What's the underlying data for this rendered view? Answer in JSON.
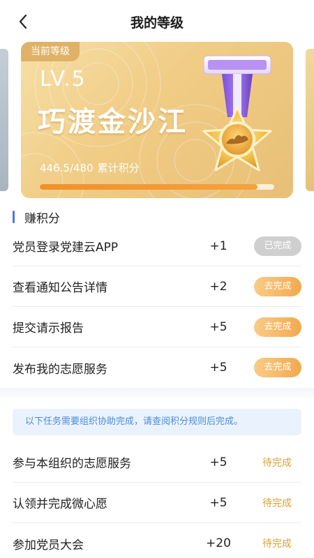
{
  "header": {
    "title": "我的等级",
    "back_icon": "chevron-left-icon"
  },
  "level_card": {
    "tag": "当前等级",
    "level": "LV.5",
    "level_name": "巧渡金沙江",
    "points": "446.5/480",
    "points_label": "累计积分",
    "progress_fraction": 0.93,
    "medal_icon": "star-medal-icon"
  },
  "earn_section": {
    "title": "赚积分",
    "tasks": [
      {
        "name": "党员登录党建云APP",
        "points": "+1",
        "status": "已完成",
        "state": "done"
      },
      {
        "name": "查看通知公告详情",
        "points": "+2",
        "status": "去完成",
        "state": "todo"
      },
      {
        "name": "提交请示报告",
        "points": "+5",
        "status": "去完成",
        "state": "todo"
      },
      {
        "name": "发布我的志愿服务",
        "points": "+5",
        "status": "去完成",
        "state": "todo"
      }
    ]
  },
  "org_section": {
    "notice": "以下任务需要组织协助完成，请查阅积分规则后完成。",
    "tasks": [
      {
        "name": "参与本组织的志愿服务",
        "points": "+5",
        "status": "待完成"
      },
      {
        "name": "认领并完成微心愿",
        "points": "+5",
        "status": "待完成"
      },
      {
        "name": "参加党员大会",
        "points": "+20",
        "status": "待完成"
      }
    ]
  },
  "colors": {
    "accent_blue": "#4a7be0",
    "progress": "#f0902b",
    "pending_text": "#d9a032",
    "done_pill": "#cfcfcf"
  }
}
